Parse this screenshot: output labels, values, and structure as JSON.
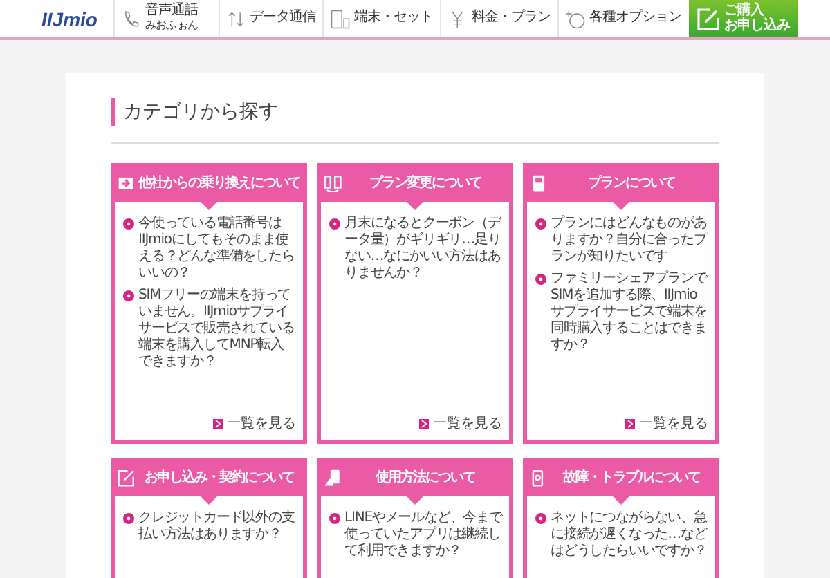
{
  "header": {
    "logo": "IIJmio",
    "nav": [
      {
        "kind": "phone",
        "label": "音声通話",
        "sublabel": "みおふぉん"
      },
      {
        "kind": "data",
        "label": "データ通信"
      },
      {
        "kind": "device",
        "label": "端末・セット"
      },
      {
        "kind": "yen",
        "label": "料金・プラン"
      },
      {
        "kind": "option",
        "label": "各種オプション"
      }
    ],
    "apply_button": {
      "label_lines": [
        "ご購入",
        "お申し込み"
      ]
    }
  },
  "section_title": "カテゴリから探す",
  "categories": [
    {
      "kind": "switch",
      "title": "他社からの乗り換えについて",
      "questions": [
        "今使っている電話番号はIIJmioにしてもそのまま使える？どんな準備をしたらいいの？",
        "SIMフリーの端末を持っていません。IIJmioサプライサービスで販売されている端末を購入してMNP転入できますか？"
      ],
      "more": "一覧を見る"
    },
    {
      "kind": "change",
      "title": "プラン変更について",
      "questions": [
        "月末になるとクーポン（データ量）がギリギリ…足りない…なにかいい方法はありませんか？"
      ],
      "more": "一覧を見る"
    },
    {
      "kind": "sim",
      "title": "プランについて",
      "questions": [
        "プランにはどんなものがありますか？自分に合ったプランが知りたいです",
        "ファミリーシェアプランでSIMを追加する際、IIJmioサプライサービスで端末を同時購入することはできますか？"
      ],
      "more": "一覧を見る"
    },
    {
      "kind": "apply",
      "title": "お申し込み・契約について",
      "questions": [
        "クレジットカード以外の支払い方法はありますか？"
      ]
    },
    {
      "kind": "usage",
      "title": "使用方法について",
      "questions": [
        "LINEやメールなど、今まで使っていたアプリは継続して利用できますか？"
      ]
    },
    {
      "kind": "trouble",
      "title": "故障・トラブルについて",
      "questions": [
        "ネットにつながらない、急に接続が遅くなった…などはどうしたらいいですか？"
      ]
    }
  ]
}
